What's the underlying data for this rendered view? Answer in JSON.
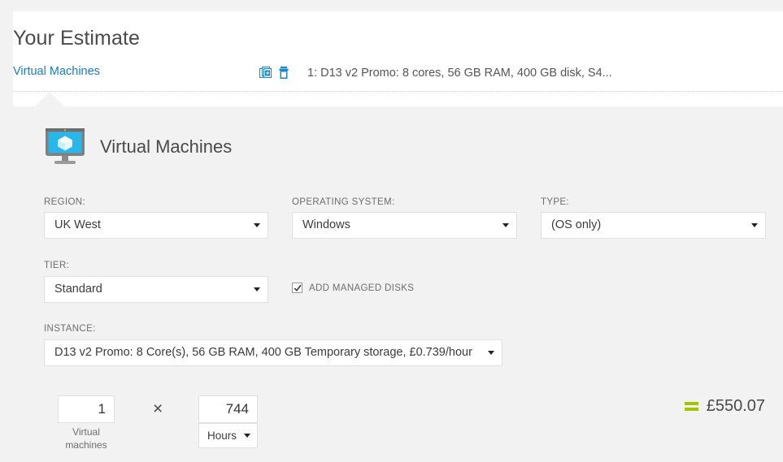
{
  "page": {
    "title": "Your Estimate"
  },
  "tabs": [
    {
      "label": "Virtual Machines",
      "summary": "1: D13 v2 Promo: 8 cores, 56 GB RAM, 400 GB disk, S4...",
      "duplicate_icon": "copy-add-icon",
      "delete_icon": "trash-icon"
    }
  ],
  "service": {
    "icon": "virtual-machine-monitor-icon",
    "title": "Virtual Machines"
  },
  "fields": {
    "region": {
      "label": "REGION:",
      "value": "UK West"
    },
    "operating_system": {
      "label": "OPERATING SYSTEM:",
      "value": "Windows"
    },
    "type": {
      "label": "TYPE:",
      "value": "(OS only)"
    },
    "tier": {
      "label": "TIER:",
      "value": "Standard"
    },
    "managed_disks": {
      "label": "ADD MANAGED DISKS",
      "checked": true
    },
    "instance": {
      "label": "INSTANCE:",
      "value": "D13 v2 Promo: 8 Core(s), 56 GB RAM, 400 GB Temporary storage, £0.739/hour"
    }
  },
  "calculator": {
    "quantity": "1",
    "quantity_caption": "Virtual machines",
    "multiply_symbol": "×",
    "hours": "744",
    "hours_unit": "Hours",
    "total": "£550.07"
  },
  "colors": {
    "link_blue": "#1a7cc7",
    "icon_blue": "#1b87c9",
    "equals_green": "#a4c400",
    "screen_cyan": "#29b6e8",
    "page_bg": "#f2f2f2",
    "card_bg": "#ffffff"
  }
}
